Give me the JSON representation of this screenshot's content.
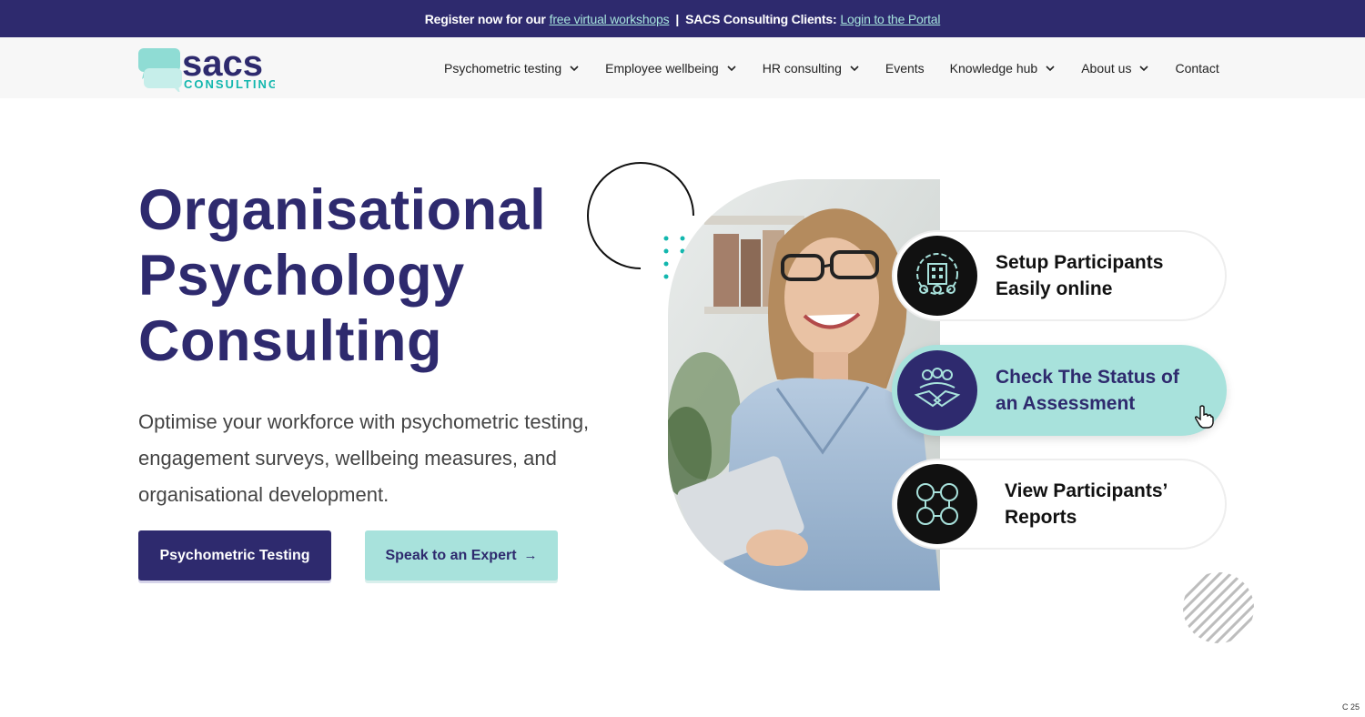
{
  "topbar": {
    "text1": "Register now for our",
    "link1": "free virtual workshops",
    "separator": "|",
    "text2": "SACS Consulting Clients:",
    "link2": "Login to the Portal"
  },
  "logo": {
    "word1": "sacs",
    "word2": "CONSULTING"
  },
  "nav": {
    "items": [
      {
        "label": "Psychometric testing",
        "dropdown": true
      },
      {
        "label": "Employee wellbeing",
        "dropdown": true
      },
      {
        "label": "HR consulting",
        "dropdown": true
      },
      {
        "label": "Events",
        "dropdown": false
      },
      {
        "label": "Knowledge hub",
        "dropdown": true
      },
      {
        "label": "About us",
        "dropdown": true
      },
      {
        "label": "Contact",
        "dropdown": false
      }
    ]
  },
  "hero": {
    "title_lines": [
      "Organisational",
      "Psychology",
      "Consulting"
    ],
    "subtitle": "Optimise your workforce with psychometric testing, engagement surveys, wellbeing measures, and organisational development.",
    "primary_button": "Psychometric Testing",
    "secondary_button": "Speak to an Expert",
    "secondary_arrow": "→"
  },
  "cards": [
    {
      "line1": "Setup Participants",
      "line2": "Easily online",
      "icon": "organisation-gear-icon"
    },
    {
      "line1": "Check The Status of",
      "line2": "an Assessment",
      "icon": "handshake-team-icon"
    },
    {
      "line1": "View Participants’",
      "line2": "Reports",
      "icon": "connected-people-icon"
    }
  ],
  "corner_label": "C 25",
  "colors": {
    "brand": "#2e2a6e",
    "accent": "#a8e2dc",
    "teal": "#13b7ae"
  }
}
